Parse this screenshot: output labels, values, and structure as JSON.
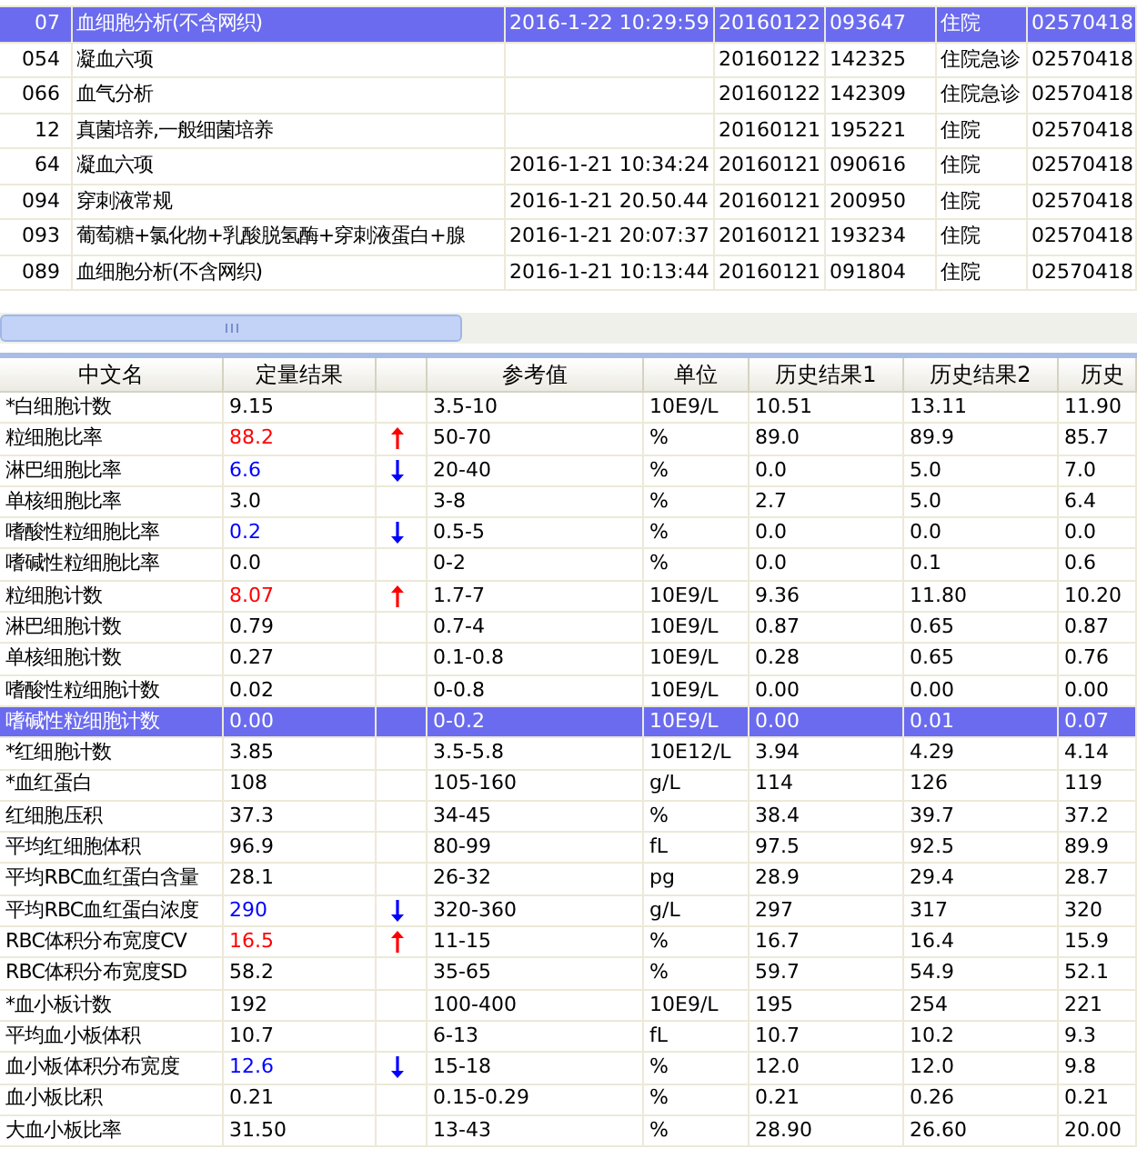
{
  "orders": [
    {
      "id": "07",
      "name": "血细胞分析(不含网织)",
      "time": "2016-1-22 10:29:59",
      "date": "20160122",
      "number": "093647",
      "type": "住院",
      "code": "02570418",
      "selected": true
    },
    {
      "id": "054",
      "name": "凝血六项",
      "date": "20160122",
      "number": "142325",
      "type": "住院急诊",
      "code": "02570418",
      "selected": false
    },
    {
      "id": "066",
      "name": "血气分析",
      "date": "20160122",
      "number": "142309",
      "type": "住院急诊",
      "code": "02570418",
      "selected": false
    },
    {
      "id": "12",
      "name": "真菌培养,一般细菌培养",
      "date": "20160121",
      "number": "195221",
      "type": "住院",
      "code": "02570418",
      "selected": false
    },
    {
      "id": "64",
      "name": "凝血六项",
      "time": "2016-1-21 10:34:24",
      "date": "20160121",
      "number": "090616",
      "type": "住院",
      "code": "02570418",
      "selected": false
    },
    {
      "id": "094",
      "name": "穿刺液常规",
      "time": "2016-1-21 20.50.44",
      "date": "20160121",
      "number": "200950",
      "type": "住院",
      "code": "02570418",
      "selected": false
    },
    {
      "id": "093",
      "name": "葡萄糖+氯化物+乳酸脱氢酶+穿刺液蛋白+腺",
      "time": "2016-1-21 20:07:37",
      "date": "20160121",
      "number": "193234",
      "type": "住院",
      "code": "02570418",
      "selected": false
    },
    {
      "id": "089",
      "name": "血细胞分析(不含网织)",
      "time": "2016-1-21 10:13:44",
      "date": "20160121",
      "number": "091804",
      "type": "住院",
      "code": "02570418",
      "selected": false
    }
  ],
  "columns": [
    "中文名",
    "定量结果",
    "参考值",
    "单位",
    "历史结果1",
    "历史结果2",
    "历史"
  ],
  "results": [
    {
      "name": "*白细胞计数",
      "value": "9.15",
      "high": false,
      "low": false,
      "ref": "3.5-10",
      "unit": "10E9/L",
      "h1": "10.51",
      "h2": "13.11",
      "h3": "11.90",
      "selected": false
    },
    {
      "name": "粒细胞比率",
      "value": "88.2",
      "high": true,
      "low": false,
      "ref": "50-70",
      "unit": "%",
      "h1": "89.0",
      "h2": "89.9",
      "h3": "85.7",
      "selected": false
    },
    {
      "name": "淋巴细胞比率",
      "value": "6.6",
      "high": false,
      "low": true,
      "ref": "20-40",
      "unit": "%",
      "h1": "0.0",
      "h2": "5.0",
      "h3": "7.0",
      "selected": false
    },
    {
      "name": "单核细胞比率",
      "value": "3.0",
      "high": false,
      "low": false,
      "ref": "3-8",
      "unit": "%",
      "h1": "2.7",
      "h2": "5.0",
      "h3": "6.4",
      "selected": false
    },
    {
      "name": "嗜酸性粒细胞比率",
      "value": "0.2",
      "high": false,
      "low": true,
      "ref": "0.5-5",
      "unit": "%",
      "h1": "0.0",
      "h2": "0.0",
      "h3": "0.0",
      "selected": false
    },
    {
      "name": "嗜碱性粒细胞比率",
      "value": "0.0",
      "high": false,
      "low": false,
      "ref": "0-2",
      "unit": "%",
      "h1": "0.0",
      "h2": "0.1",
      "h3": "0.6",
      "selected": false
    },
    {
      "name": "粒细胞计数",
      "value": "8.07",
      "high": true,
      "low": false,
      "ref": "1.7-7",
      "unit": "10E9/L",
      "h1": "9.36",
      "h2": "11.80",
      "h3": "10.20",
      "selected": false
    },
    {
      "name": "淋巴细胞计数",
      "value": "0.79",
      "high": false,
      "low": false,
      "ref": "0.7-4",
      "unit": "10E9/L",
      "h1": "0.87",
      "h2": "0.65",
      "h3": "0.87",
      "selected": false
    },
    {
      "name": "单核细胞计数",
      "value": "0.27",
      "high": false,
      "low": false,
      "ref": "0.1-0.8",
      "unit": "10E9/L",
      "h1": "0.28",
      "h2": "0.65",
      "h3": "0.76",
      "selected": false
    },
    {
      "name": "嗜酸性粒细胞计数",
      "value": "0.02",
      "high": false,
      "low": false,
      "ref": "0-0.8",
      "unit": "10E9/L",
      "h1": "0.00",
      "h2": "0.00",
      "h3": "0.00",
      "selected": false
    },
    {
      "name": "嗜碱性粒细胞计数",
      "value": "0.00",
      "high": false,
      "low": false,
      "ref": "0-0.2",
      "unit": "10E9/L",
      "h1": "0.00",
      "h2": "0.01",
      "h3": "0.07",
      "selected": true
    },
    {
      "name": "*红细胞计数",
      "value": "3.85",
      "high": false,
      "low": false,
      "ref": "3.5-5.8",
      "unit": "10E12/L",
      "h1": "3.94",
      "h2": "4.29",
      "h3": "4.14",
      "selected": false
    },
    {
      "name": "*血红蛋白",
      "value": "108",
      "high": false,
      "low": false,
      "ref": "105-160",
      "unit": "g/L",
      "h1": "114",
      "h2": "126",
      "h3": "119",
      "selected": false
    },
    {
      "name": "红细胞压积",
      "value": "37.3",
      "high": false,
      "low": false,
      "ref": "34-45",
      "unit": "%",
      "h1": "38.4",
      "h2": "39.7",
      "h3": "37.2",
      "selected": false
    },
    {
      "name": "平均红细胞体积",
      "value": "96.9",
      "high": false,
      "low": false,
      "ref": "80-99",
      "unit": "fL",
      "h1": "97.5",
      "h2": "92.5",
      "h3": "89.9",
      "selected": false
    },
    {
      "name": "平均RBC血红蛋白含量",
      "value": "28.1",
      "high": false,
      "low": false,
      "ref": "26-32",
      "unit": "pg",
      "h1": "28.9",
      "h2": "29.4",
      "h3": "28.7",
      "selected": false
    },
    {
      "name": "平均RBC血红蛋白浓度",
      "value": "290",
      "high": false,
      "low": true,
      "ref": "320-360",
      "unit": "g/L",
      "h1": "297",
      "h2": "317",
      "h3": "320",
      "selected": false
    },
    {
      "name": "RBC体积分布宽度CV",
      "value": "16.5",
      "high": true,
      "low": false,
      "ref": "11-15",
      "unit": "%",
      "h1": "16.7",
      "h2": "16.4",
      "h3": "15.9",
      "selected": false
    },
    {
      "name": "RBC体积分布宽度SD",
      "value": "58.2",
      "high": false,
      "low": false,
      "ref": "35-65",
      "unit": "%",
      "h1": "59.7",
      "h2": "54.9",
      "h3": "52.1",
      "selected": false
    },
    {
      "name": "*血小板计数",
      "value": "192",
      "high": false,
      "low": false,
      "ref": "100-400",
      "unit": "10E9/L",
      "h1": "195",
      "h2": "254",
      "h3": "221",
      "selected": false
    },
    {
      "name": "平均血小板体积",
      "value": "10.7",
      "high": false,
      "low": false,
      "ref": "6-13",
      "unit": "fL",
      "h1": "10.7",
      "h2": "10.2",
      "h3": "9.3",
      "selected": false
    },
    {
      "name": "血小板体积分布宽度",
      "value": "12.6",
      "high": false,
      "low": true,
      "ref": "15-18",
      "unit": "%",
      "h1": "12.0",
      "h2": "12.0",
      "h3": "9.8",
      "selected": false
    },
    {
      "name": "血小板比积",
      "value": "0.21",
      "high": false,
      "low": false,
      "ref": "0.15-0.29",
      "unit": "%",
      "h1": "0.21",
      "h2": "0.26",
      "h3": "0.21",
      "selected": false
    },
    {
      "name": "大血小板比率",
      "value": "31.50",
      "high": false,
      "low": false,
      "ref": "13-43",
      "unit": "%",
      "h1": "28.90",
      "h2": "26.60",
      "h3": "20.00",
      "selected": false
    }
  ]
}
